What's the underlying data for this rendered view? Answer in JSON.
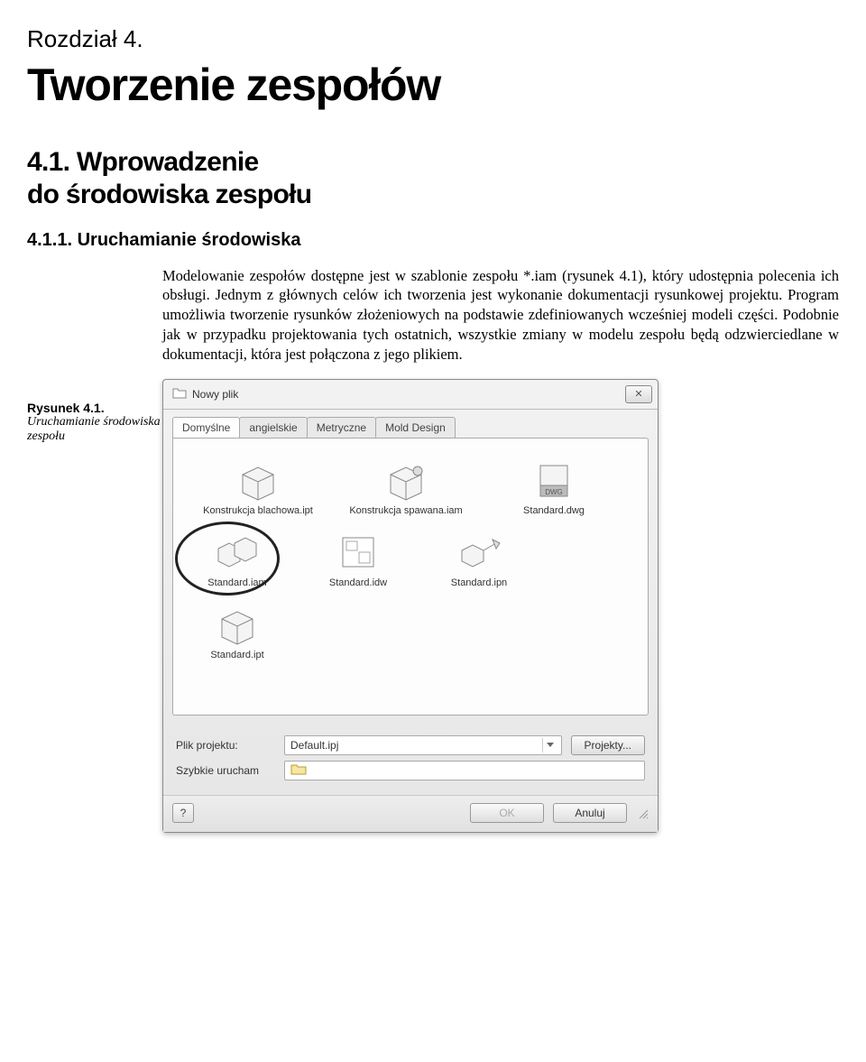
{
  "chapter": {
    "label": "Rozdział 4.",
    "title": "Tworzenie zespołów"
  },
  "section": {
    "number_line": "4.1. Wprowadzenie",
    "sub_line": "do środowiska zespołu"
  },
  "subsection": "4.1.1. Uruchamianie środowiska",
  "paragraph": "Modelowanie zespołów dostępne jest w szablonie zespołu *.iam (rysunek 4.1), który udostępnia polecenia ich obsługi. Jednym z głównych celów ich tworzenia jest wykonanie dokumentacji rysunkowej projektu. Program umożliwia tworzenie rysunków złożeniowych na podstawie zdefiniowanych wcześniej modeli części. Podobnie jak w przypadku projektowania tych ostatnich, wszystkie zmiany w modelu zespołu będą odzwierciedlane w dokumentacji, która jest połączona z jego plikiem.",
  "figure": {
    "caption_title": "Rysunek 4.1.",
    "caption_sub": "Uruchamianie środowiska zespołu"
  },
  "dialog": {
    "title": "Nowy plik",
    "tabs": [
      "Domyślne",
      "angielskie",
      "Metryczne",
      "Mold Design"
    ],
    "active_tab": 0,
    "items_row1": [
      {
        "label": "Konstrukcja blachowa.ipt"
      },
      {
        "label": "Konstrukcja spawana.iam"
      },
      {
        "label": "Standard.dwg"
      }
    ],
    "items_row2": [
      {
        "label": "Standard.iam"
      },
      {
        "label": "Standard.idw"
      },
      {
        "label": "Standard.ipn"
      }
    ],
    "items_row3": [
      {
        "label": "Standard.ipt"
      }
    ],
    "project_label": "Plik projektu:",
    "project_value": "Default.ipj",
    "projects_btn": "Projekty...",
    "quick_label": "Szybkie urucham",
    "ok": "OK",
    "cancel": "Anuluj",
    "help": "?"
  },
  "icons": {
    "box": "box-cube-icon",
    "weld": "welded-cube-icon",
    "dwg": "dwg-file-icon",
    "asm": "assembly-cubes-icon",
    "idw": "drawing-sheet-icon",
    "ipn": "presentation-icon"
  }
}
